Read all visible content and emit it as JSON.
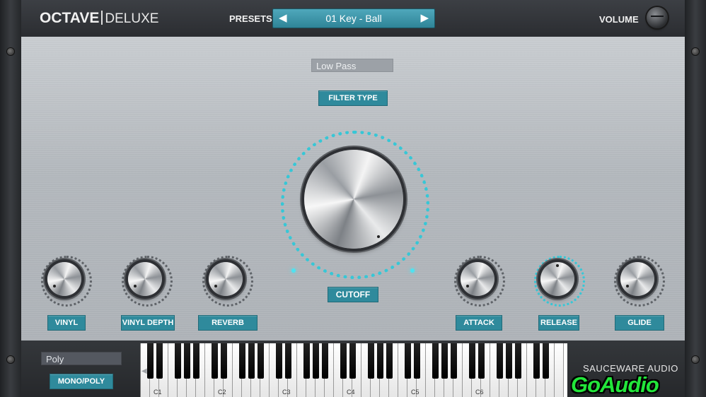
{
  "header": {
    "logo_main": "OCTAVE",
    "logo_sub": "DELUXE",
    "presets_label": "PRESETS",
    "preset_name": "01 Key - Ball",
    "prev_arrow": "◀",
    "next_arrow": "▶",
    "volume_label": "VOLUME"
  },
  "filter": {
    "type_value": "Low Pass",
    "type_label": "FILTER TYPE",
    "cutoff_label": "CUTOFF"
  },
  "knobs": {
    "vinyl": "VINYL",
    "vinyl_depth": "VINYL DEPTH",
    "reverb": "REVERB",
    "attack": "ATTACK",
    "release": "RELEASE",
    "glide": "GLIDE"
  },
  "bottom": {
    "mode_value": "Poly",
    "mode_label": "MONO/POLY",
    "brand": "SAUCEWARE AUDIO",
    "scroll_left": "◀"
  },
  "keyboard": {
    "octaves": [
      "C1",
      "C2",
      "C3",
      "C4",
      "C5",
      "C6"
    ]
  },
  "watermark": "GoAudio",
  "colors": {
    "accent": "#2f8a9c",
    "led": "#37c7d6",
    "watermark": "#22e63a"
  }
}
